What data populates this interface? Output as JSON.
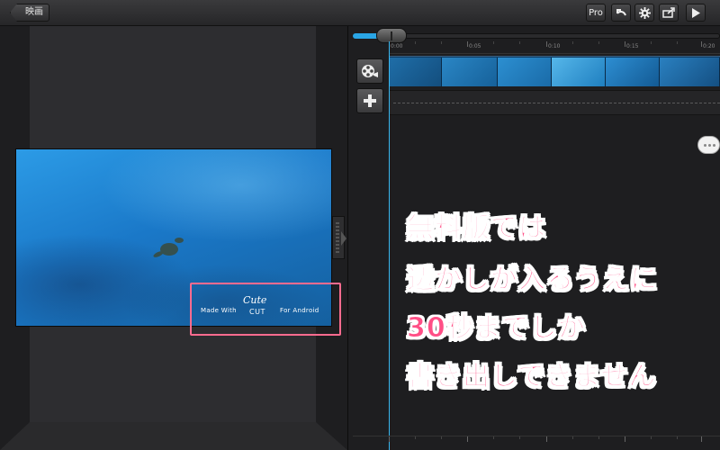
{
  "toolbar": {
    "back_label": "映画",
    "pro_label": "Pro",
    "icons": [
      "undo-icon",
      "gear-icon",
      "share-icon",
      "play-icon"
    ]
  },
  "watermark": {
    "made_with": "Made With",
    "cute": "Cute",
    "cut": "CUT",
    "for_android": "For Android"
  },
  "timeline": {
    "ruler_labels": [
      "0:00",
      "0:05",
      "0:10",
      "0:15",
      "0:20"
    ],
    "track_buttons": [
      "film-reel-icon",
      "plus-icon"
    ]
  },
  "caption": {
    "lines": [
      "無料版では",
      "透かしが入るうえに",
      "30秒までしか",
      "書き出しできません"
    ]
  },
  "colors": {
    "accent": "#2aa6e6",
    "playhead": "#39b7ef",
    "caption": "#ff4f86",
    "highlight": "#ff6b8f"
  }
}
